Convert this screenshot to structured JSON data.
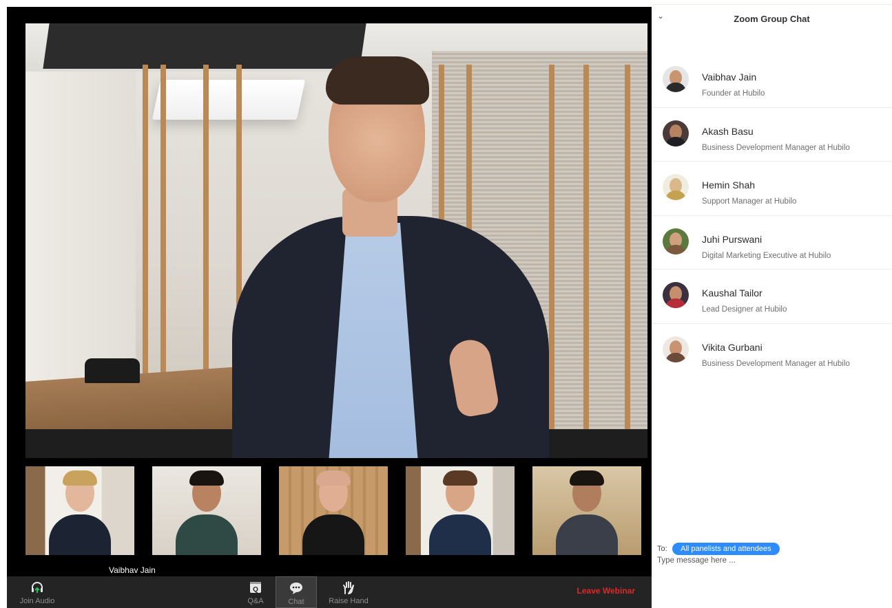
{
  "chat": {
    "title": "Zoom Group Chat",
    "collapse_icon": "chevron-down-icon",
    "attendees": [
      {
        "name": "Vaibhav Jain",
        "role": "Founder at Hubilo"
      },
      {
        "name": "Akash Basu",
        "role": "Business Development Manager at Hubilo"
      },
      {
        "name": "Hemin Shah",
        "role": "Support Manager at Hubilo"
      },
      {
        "name": "Juhi Purswani",
        "role": "Digital Marketing Executive at Hubilo"
      },
      {
        "name": "Kaushal Tailor",
        "role": "Lead Designer at Hubilo"
      },
      {
        "name": "Vikita Gurbani",
        "role": "Business Development Manager at Hubilo"
      }
    ],
    "to_label": "To:",
    "recipient": "All panelists and attendees",
    "message_placeholder": "Type message here ..."
  },
  "video": {
    "thumbnail_caption": "Vaibhav Jain"
  },
  "toolbar": {
    "join_audio": "Join Audio",
    "qa": "Q&A",
    "chat": "Chat",
    "raise_hand": "Raise Hand",
    "leave": "Leave Webinar"
  },
  "colors": {
    "accent": "#2d8cff",
    "leave": "#e02828",
    "toolbar_bg": "#242424",
    "join_audio_arrow": "#22c55e"
  }
}
